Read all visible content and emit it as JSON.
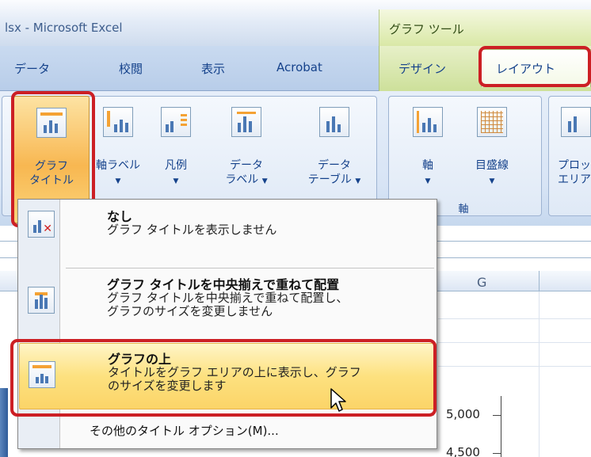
{
  "window": {
    "title": "lsx - Microsoft Excel",
    "context_group": "グラフ ツール"
  },
  "tabs": {
    "data": "データ",
    "review": "校閲",
    "view": "表示",
    "acrobat": "Acrobat",
    "design": "デザイン",
    "layout": "レイアウト"
  },
  "ribbon": {
    "chart_title": {
      "line1": "グラフ",
      "line2": "タイトル",
      "arrow": "▼"
    },
    "axis_titles": {
      "line1": "軸ラベル",
      "arrow": "▼"
    },
    "legend": {
      "line1": "凡例",
      "arrow": "▼"
    },
    "data_labels": {
      "line1": "データ",
      "line2": "ラベル",
      "arrow": "▼"
    },
    "data_table": {
      "line1": "データ",
      "line2": "テーブル",
      "arrow": "▼"
    },
    "axes": {
      "line1": "軸",
      "arrow": "▼"
    },
    "gridlines": {
      "line1": "目盛線",
      "arrow": "▼"
    },
    "plot_area": {
      "line1": "プロッ",
      "line2": "エリア"
    },
    "axes_group_label": "軸"
  },
  "sheet": {
    "column_g": "G",
    "axis_ticks": [
      "5,000",
      "4,500"
    ]
  },
  "menu": {
    "items": [
      {
        "title": "なし",
        "desc1": "グラフ タイトルを表示しません",
        "desc2": ""
      },
      {
        "title": "グラフ タイトルを中央揃えで重ねて配置",
        "desc1": "グラフ タイトルを中央揃えで重ねて配置し、",
        "desc2": "グラフのサイズを変更しません"
      },
      {
        "title": "グラフの上",
        "desc1": "タイトルをグラフ エリアの上に表示し、グラフ",
        "desc2": "のサイズを変更します"
      }
    ],
    "more_options": "その他のタイトル オプション(M)..."
  },
  "colors": {
    "highlight_red": "#cc1f24",
    "hover_gold": "#fde17f",
    "context_green": "#d9e8a6"
  }
}
